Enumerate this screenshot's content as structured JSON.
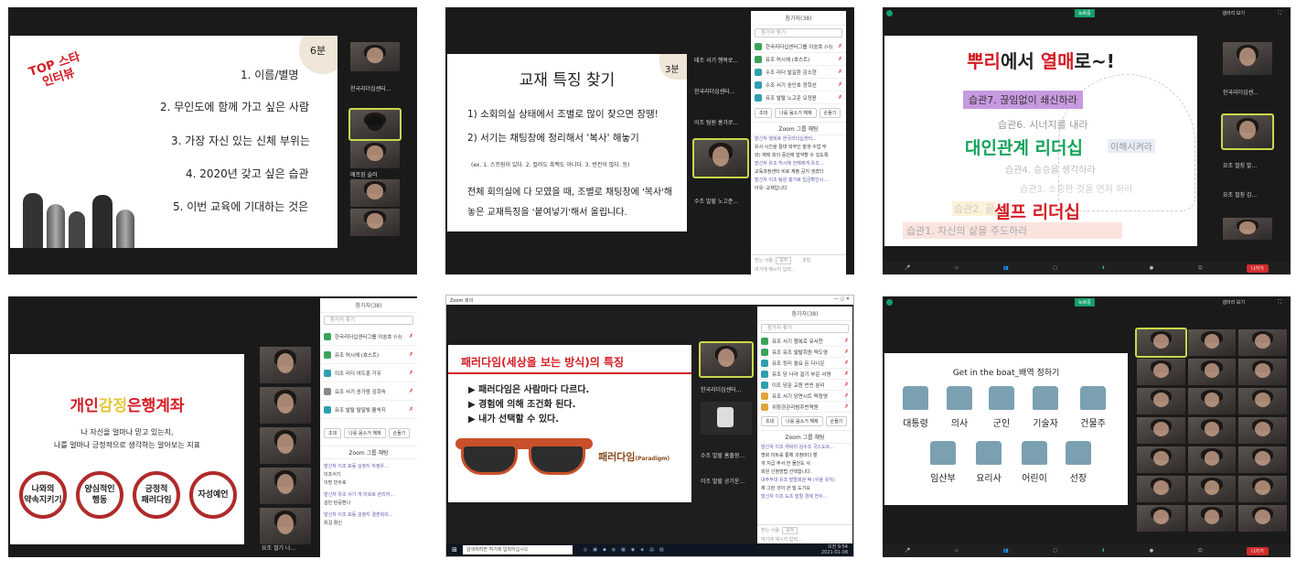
{
  "p1": {
    "top_star": "TOP 스타",
    "interview": "인터뷰",
    "minutes": "6분",
    "items": [
      "1.   이름/별명",
      "2.   무인도에 함께 가고 싶은 사람",
      "3.   가장 자신 있는 신체 부위는",
      "4.   2020년 갖고 싶은 습관",
      "5.   이번 교육에 기대하는 것은"
    ],
    "vid_labels": [
      "한국리더십센터...",
      "",
      "애프짐 슬러"
    ]
  },
  "p2": {
    "title": "교재 특징 찾기",
    "minutes": "3분",
    "lines": [
      "1) 소회의실 상태에서 조별로 많이 찾으면 장땡!",
      "2) 서기는 채팅창에 정리해서 '복사' 해놓기"
    ],
    "example": "(ex. 1. 스프링이 있다. 2. 컬러도 흑백도 아니다. 3. 빈칸이 많다. 등)",
    "final": [
      "전체 회의실에 다 모였을 때, 조별로 채팅창에 '복사'해",
      "놓은 교재특징을 '붙여넣기'해서 올립니다."
    ],
    "vid_labels": [
      "태조 서기 행복로...",
      "한국리더십센터...",
      "이조 팀원 홍가로...",
      "",
      "수조 발랄 노고준..."
    ],
    "chat_header": "참가자(38)",
    "search": "참가자 찾기",
    "participants": [
      "한국리더십센터그룹 이숭호 (나)",
      "유조 허시헤 (호스트)",
      "수조 리더 발길환 김소현",
      "수조 서기 송인호 정희선",
      "유조 발랄 노고준 오정윤"
    ],
    "btn_invite": "초대",
    "btn_mute": "나를 음소거 해제",
    "btn_more": "손들기",
    "zoom_chat": "Zoom 그룹 채팅",
    "messages": [
      "발신자 행복로 한국리더십센터...",
      "유사 시간을 절대 외부인 발생 수업 무",
      "와) 재택 회의 중단에 협약할 수 있도록",
      "발신자 유조 허시헤 전체에게 유조...",
      "교육과정센터 비로 제출 공지 생겼다",
      "발신자 이조 팀원 홍가로 입금확인시...",
      "이유: 교재입니다"
    ],
    "to_label": "받는 사람:",
    "to_value": "모두",
    "file": "파일",
    "input_placeholder": "여기에 메시지 입력..."
  },
  "p3": {
    "title_parts": [
      "뿌리",
      "에서 ",
      "열매",
      "로~!"
    ],
    "habit7": "습관7. 끊임없이 쇄신하라",
    "habit6": "습관6. 시너지를 내라",
    "habit5": "이해시켜라",
    "big1": "대인관계 리더십",
    "habit4": "습관4. 승승을 생각하라",
    "habit3": "습관3. 소중한 것을 먼저 하라",
    "habit2": "습관2. 끝",
    "big2": "셀프 리더십",
    "habit1": "습관1. 자신의 삶을 주도하라",
    "rec": "녹화중",
    "view": "갤러리 보기",
    "end": "나가기",
    "vid_labels": [
      "한국리더십센...",
      "",
      "요조 절칭 발...",
      "요조 절칭 김...",
      ""
    ]
  },
  "p4": {
    "title_a": "개인",
    "title_b": "감정",
    "title_c": "은행계좌",
    "sub1": "나 자신을 얼마나 믿고 있는지,",
    "sub2": "나를 얼마나 긍정적으로 생각하는 알아보는 지표",
    "circles": [
      "나와의\n약속지키기",
      "양심적인\n행동",
      "긍정적\n패러다임",
      "자성예언"
    ],
    "chat_header": "참가자(38)",
    "search": "참가자 찾기",
    "participants": [
      "한국리더십센터그룹 이숭호 (나)",
      "유조 허시헤 (호스트)",
      "이조 리더 여도훈 기우",
      "요조 서기 송가람 김희숙",
      "유조 발랄 탈밀빛 활속지"
    ],
    "btn_invite": "초대",
    "btn_mute": "나를 음소거 해제",
    "btn_more": "손들기",
    "zoom_chat": "Zoom 그룹 채팅",
    "messages": [
      "발신자 이조 표동 김정지 자정우...",
      "이조서기",
      "이방 민수호",
      "발신자 유조 서기 개 미북로 관리자...",
      "김민 탄공환나",
      "발신자 이조 표동 김정지 결혼회의...",
      "위걸 활인"
    ],
    "vid_labels": [
      "",
      "",
      "",
      "",
      "요조 절기 나..."
    ]
  },
  "p5": {
    "window_title": "Zoom 회의",
    "title_a": "패러다임",
    "title_b": "(세상을 보는 방식)의 특징",
    "bullets": [
      "▶ 패러다임은 사람마다 다르다.",
      "▶ 경험에 의해 조건화 된다.",
      "▶ 내가 선택할 수 있다."
    ],
    "label": "패러다임",
    "label_en": "(Paradigm)",
    "chat_header": "참가자(38)",
    "search": "참가자 찾기",
    "participants": [
      "유조 서기 행복로 유사천",
      "유조 유조 발랄회원 떡도영",
      "유조 정리 월요 돈 다니운",
      "유조 당 나라 걸기 부운 서영",
      "이조 당문 교원 빈빈 분리",
      "유조 서기 당면시트 떡정영",
      "위장관관리범주번역원"
    ],
    "btn_invite": "초대",
    "btn_mute": "나를 음소거 해제",
    "btn_more": "손들기",
    "zoom_chat": "Zoom 그룹 채팅",
    "messages": [
      "발신자 이조 캐릭터 김수조 국스도트...",
      "명화 마트를 통해 과정마다 할",
      "개 지급 주서 한 물건도 사",
      "회원 신청방법 선택합니다.",
      "내주부대 유조 발랄회원 떡 (우울 유지)",
      "제 그린 것이 관 빌 도기요",
      "발신자 이조 도조 발랄 경제 연수..."
    ],
    "vid_labels": [
      "한국리더십센터...",
      "",
      "수조 발랄 홈출장...",
      "이조 발랄 공기운..."
    ],
    "to_label": "받는 사람:",
    "to_value": "모두",
    "input_placeholder": "여기에 메시지 입력...",
    "taskbar_search": "검색하려면 여기에 입력하십시오",
    "clock": "오전 9:54",
    "date": "2021-01-08"
  },
  "p6": {
    "title": "Get in the boat_배역 정하기",
    "jobs": [
      "대통령",
      "의사",
      "군인",
      "기술자",
      "건물주",
      "임산부",
      "요리사",
      "어린이",
      "선장"
    ],
    "rec": "녹화중",
    "view": "갤러리 보기",
    "end": "나가기"
  },
  "colors": {
    "red": "#d31c24",
    "green_rec": "#14a06b",
    "zoom_bg": "#1a1a1a"
  }
}
